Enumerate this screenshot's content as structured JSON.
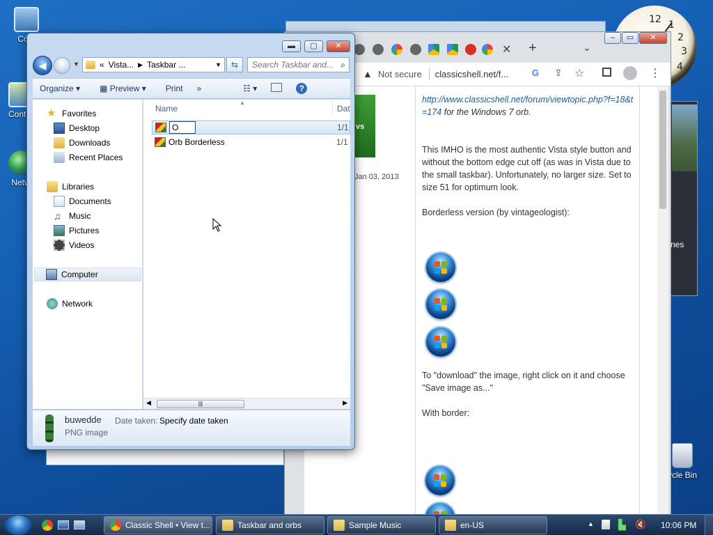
{
  "desktop": {
    "icons": [
      {
        "label": "Com"
      },
      {
        "label": "Contro"
      },
      {
        "label": "Netw"
      },
      {
        "label": "ycle Bin"
      }
    ],
    "clock_numbers": [
      "12",
      "1",
      "2",
      "3",
      "4"
    ]
  },
  "background_windows": {
    "partial_text_1": "Jan 03, 2013",
    "partial_text_2": "nes",
    "partial_text_3": "vs"
  },
  "explorer": {
    "breadcrumb": [
      "«",
      "Vista...",
      "Taskbar ..."
    ],
    "search_placeholder": "Search Taskbar and...",
    "toolbar": {
      "organize": "Organize",
      "preview": "Preview",
      "print": "Print",
      "more": "»"
    },
    "nav": {
      "favorites": "Favorites",
      "desktop": "Desktop",
      "downloads": "Downloads",
      "recent": "Recent Places",
      "libraries": "Libraries",
      "documents": "Documents",
      "music": "Music",
      "pictures": "Pictures",
      "videos": "Videos",
      "computer": "Computer",
      "network": "Network"
    },
    "columns": {
      "name": "Name",
      "date": "Dat"
    },
    "files": [
      {
        "name": "O",
        "date": "1/1",
        "renaming": true
      },
      {
        "name": "Orb Borderless",
        "date": "1/1",
        "renaming": false
      }
    ],
    "details": {
      "file_name": "buwedde",
      "file_type": "PNG image",
      "date_label": "Date taken:",
      "date_value": "Specify date taken"
    }
  },
  "chrome": {
    "security": "Not secure",
    "url": "classicshell.net/f...",
    "post": {
      "link": "http://www.classicshell.net/forum/viewtopic.php?f=18&t=174",
      "link_suffix": " for the Windows 7 orb.",
      "para1": "This IMHO is the most authentic Vista style button and without the bottom edge cut off (as was in Vista due to the small taskbar). Unfortunately, no larger size. Set to size 51 for optimum look.",
      "para2": "Borderless version (by vintageologist):",
      "para3": "To \"download\" the image, right click on it and choose \"Save image as...\"",
      "para4": "With border:"
    }
  },
  "taskbar": {
    "buttons": [
      {
        "label": "Classic Shell • View t..."
      },
      {
        "label": "Taskbar and orbs"
      },
      {
        "label": "Sample Music"
      },
      {
        "label": "en-US"
      }
    ],
    "time": "10:06 PM"
  },
  "colors": {
    "desktop_blue": "#1660b4",
    "link_blue": "#1f5c99",
    "taskbar": "#1c3556"
  }
}
